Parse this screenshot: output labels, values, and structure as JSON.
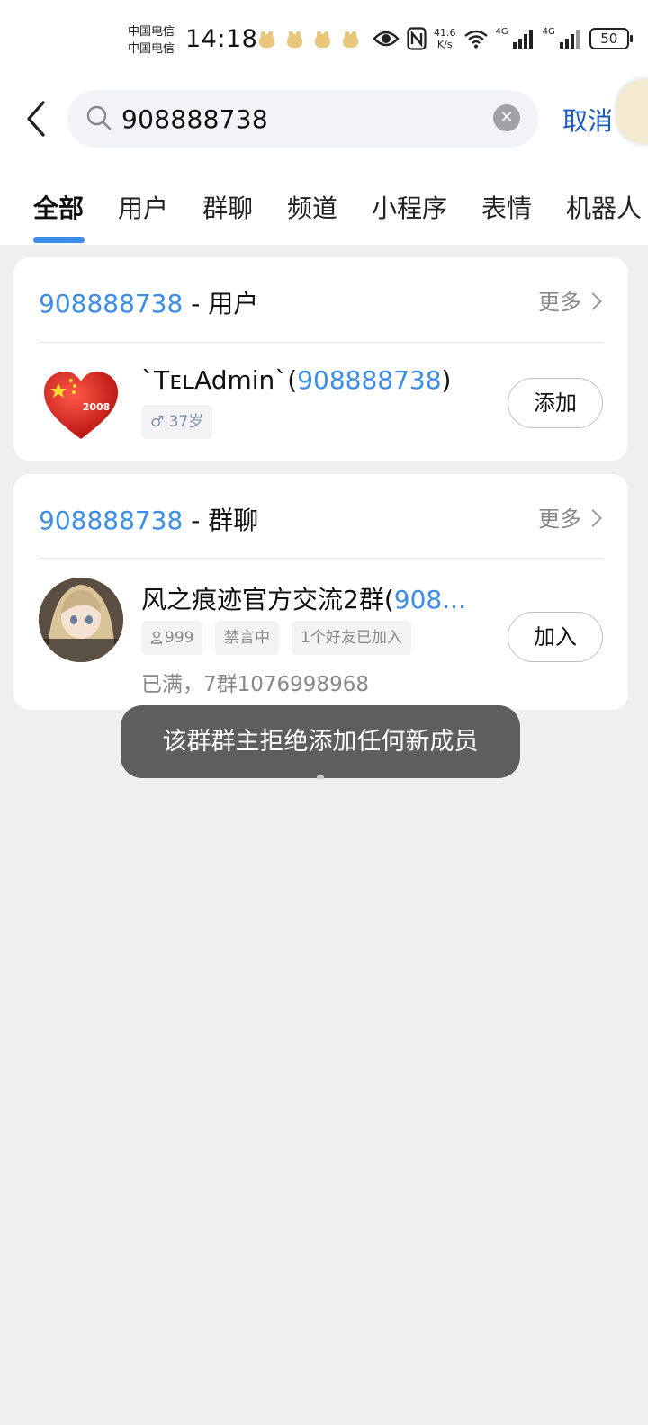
{
  "status_bar": {
    "carrier_1": "中国电信",
    "carrier_2": "中国电信",
    "time": "14:18",
    "speed_top": "41.6",
    "speed_bottom": "K/s",
    "signal_1_label": "4G",
    "signal_2_label": "4G",
    "battery": "50",
    "icons": [
      "cat-icon",
      "eye-icon",
      "nfc-icon",
      "wifi-icon",
      "signal-icon",
      "battery-icon"
    ]
  },
  "search": {
    "query": "908888738",
    "cancel_label": "取消"
  },
  "tabs": [
    {
      "label": "全部",
      "active": true
    },
    {
      "label": "用户",
      "active": false
    },
    {
      "label": "群聊",
      "active": false
    },
    {
      "label": "频道",
      "active": false
    },
    {
      "label": "小程序",
      "active": false
    },
    {
      "label": "表情",
      "active": false
    },
    {
      "label": "机器人",
      "active": false
    }
  ],
  "users_section": {
    "query": "908888738",
    "title_suffix": " - 用户",
    "more_label": "更多",
    "result": {
      "name_prefix": "`TᴇʟAdmin`(",
      "uin": "908888738",
      "name_suffix": ")",
      "gender_age": "♂ 37岁",
      "add_label": "添加"
    }
  },
  "groups_section": {
    "query": "908888738",
    "title_suffix": " - 群聊",
    "more_label": "更多",
    "result": {
      "name": "风之痕迹官方交流2群(",
      "uin_partial": "908...",
      "member_count": "999",
      "tag_muted": "禁言中",
      "tag_friends": "1个好友已加入",
      "description": "已满，7群1076998968",
      "join_label": "加入"
    }
  },
  "toast": {
    "message": "该群群主拒绝添加任何新成员"
  },
  "colors": {
    "accent": "#3c8de8",
    "cancel": "#1b58b8",
    "background": "#efeff2"
  }
}
